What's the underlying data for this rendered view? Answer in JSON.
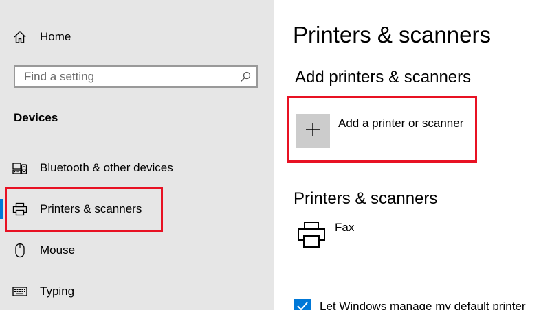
{
  "sidebar": {
    "home_label": "Home",
    "search_placeholder": "Find a setting",
    "section_title": "Devices",
    "items": [
      {
        "label": "Bluetooth & other devices",
        "icon": "bluetooth-devices-icon"
      },
      {
        "label": "Printers & scanners",
        "icon": "printer-icon",
        "active": true
      },
      {
        "label": "Mouse",
        "icon": "mouse-icon"
      },
      {
        "label": "Typing",
        "icon": "keyboard-icon"
      }
    ]
  },
  "main": {
    "title": "Printers & scanners",
    "add_section_title": "Add printers & scanners",
    "add_button_label": "Add a printer or scanner",
    "list_section_title": "Printers & scanners",
    "devices": [
      {
        "name": "Fax",
        "icon": "printer-icon"
      }
    ],
    "default_printer_checkbox_label": "Let Windows manage my default printer",
    "default_printer_checked": true
  },
  "colors": {
    "sidebar_bg": "#e6e6e6",
    "accent": "#0078d7",
    "highlight_box": "#e81123",
    "add_tile_bg": "#cccccc"
  }
}
